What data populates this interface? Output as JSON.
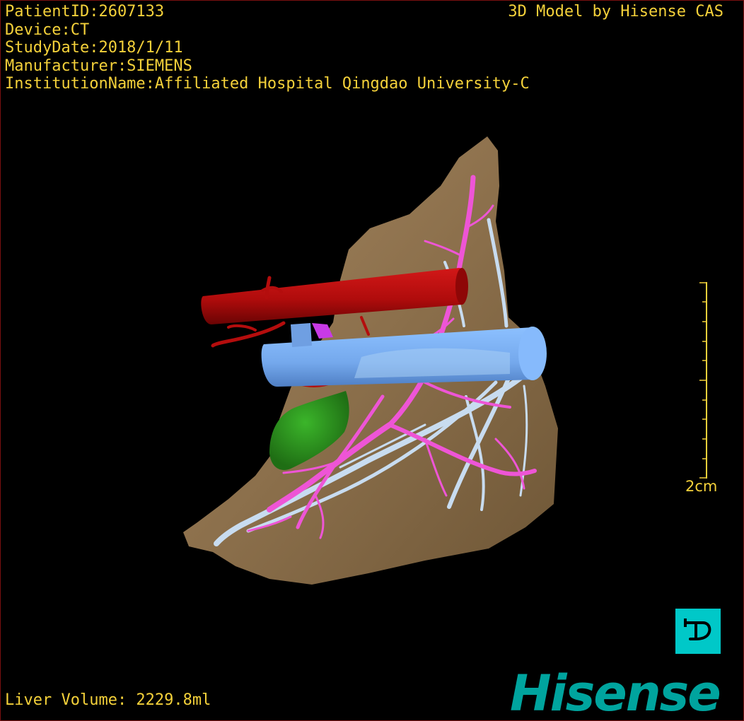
{
  "info": {
    "patient_id": "PatientID:2607133",
    "device": "Device:CT",
    "study_date": "StudyDate:2018/1/11",
    "manufacturer": "Manufacturer:SIEMENS",
    "institution": "InstitutionName:Affiliated Hospital Qingdao University-C"
  },
  "credit": "3D Model by Hisense CAS",
  "liver_volume": "Liver Volume: 2229.8ml",
  "scale_bar": {
    "label": "2cm"
  },
  "logo": {
    "text": "Hisense"
  },
  "p_button": {
    "icon": "p-icon"
  },
  "colors": {
    "text": "#f4d13a",
    "liver": "#8a6e4a",
    "artery": "#b40d0d",
    "vein": "#78aef0",
    "hepatic_vessels": "#ee55d6",
    "portal_branches": "#c8dcf0",
    "gallbladder": "#2c9a1c",
    "brand": "#00a49e",
    "p_button": "#00c8c8"
  }
}
